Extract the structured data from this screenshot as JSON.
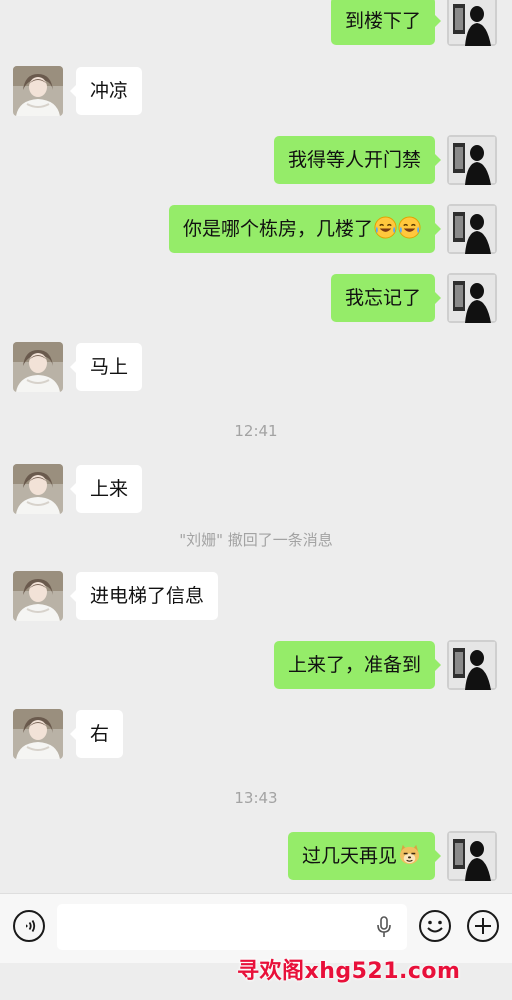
{
  "messages": [
    {
      "side": "right",
      "text": "到楼下了"
    },
    {
      "side": "left",
      "text": "冲凉"
    },
    {
      "side": "right",
      "text": "我得等人开门禁"
    },
    {
      "side": "right",
      "text": "你是哪个栋房，几楼了"
    },
    {
      "side": "right",
      "text": "我忘记了"
    },
    {
      "side": "left",
      "text": "马上"
    },
    {
      "side": "left",
      "text": "上来"
    },
    {
      "side": "left",
      "text": "进电梯了信息"
    },
    {
      "side": "right",
      "text": "上来了，准备到"
    },
    {
      "side": "left",
      "text": "右"
    },
    {
      "side": "right",
      "text": "过几天再见"
    }
  ],
  "timestamps": [
    "12:41",
    "13:43"
  ],
  "recall_notice": "\"刘姗\" 撤回了一条消息",
  "emoji": {
    "laugh_cry": "laugh-cry-emoji",
    "doge": "doge-emoji"
  },
  "input_bar": {
    "voice_icon": "voice-icon",
    "mic_icon": "mic-icon",
    "smiley_icon": "smiley-icon",
    "plus_icon": "plus-icon",
    "text_value": ""
  },
  "watermark": "寻欢阁xhg521.com",
  "colors": {
    "background": "#ededed",
    "sent_bubble": "#95ec69",
    "received_bubble": "#ffffff",
    "system_text": "#a3a3a3",
    "watermark": "#e8103a"
  }
}
